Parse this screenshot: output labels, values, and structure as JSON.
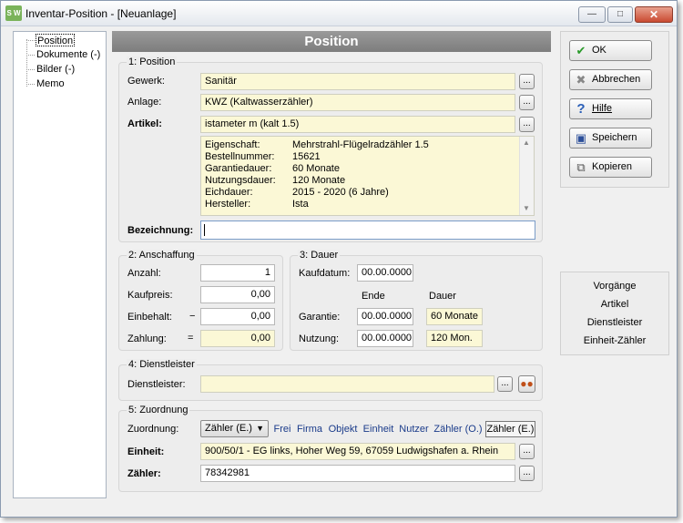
{
  "window": {
    "title": "Inventar-Position - [Neuanlage]",
    "icon_text": "S W"
  },
  "tree": {
    "items": [
      "Position",
      "Dokumente (-)",
      "Bilder (-)",
      "Memo"
    ]
  },
  "header": {
    "title": "Position"
  },
  "position": {
    "group_title": "1: Position",
    "gewerk_label": "Gewerk:",
    "gewerk_value": "Sanitär",
    "anlage_label": "Anlage:",
    "anlage_value": "KWZ (Kaltwasserzähler)",
    "artikel_label": "Artikel:",
    "artikel_value": "istameter m (kalt 1.5)",
    "info": [
      {
        "key": "Eigenschaft:",
        "value": "Mehrstrahl-Flügelradzähler 1.5"
      },
      {
        "key": "Bestellnummer:",
        "value": "15621"
      },
      {
        "key": "Garantiedauer:",
        "value": "60 Monate"
      },
      {
        "key": "Nutzungsdauer:",
        "value": "120 Monate"
      },
      {
        "key": "Eichdauer:",
        "value": "2015 - 2020 (6 Jahre)"
      },
      {
        "key": "Hersteller:",
        "value": "Ista"
      }
    ],
    "bezeichnung_label": "Bezeichnung:",
    "bezeichnung_value": ""
  },
  "anschaffung": {
    "group_title": "2: Anschaffung",
    "anzahl_label": "Anzahl:",
    "anzahl_value": "1",
    "kaufpreis_label": "Kaufpreis:",
    "kaufpreis_value": "0,00",
    "einbehalt_label": "Einbehalt:",
    "einbehalt_sign": "−",
    "einbehalt_value": "0,00",
    "zahlung_label": "Zahlung:",
    "zahlung_sign": "=",
    "zahlung_value": "0,00"
  },
  "dauer": {
    "group_title": "3: Dauer",
    "kaufdatum_label": "Kaufdatum:",
    "kaufdatum_value": "00.00.0000",
    "col_ende": "Ende",
    "col_dauer": "Dauer",
    "garantie_label": "Garantie:",
    "garantie_ende": "00.00.0000",
    "garantie_dauer": "60 Monate",
    "nutzung_label": "Nutzung:",
    "nutzung_ende": "00.00.0000",
    "nutzung_dauer": "120 Mon."
  },
  "dienstleister": {
    "group_title": "4: Dienstleister",
    "label": "Dienstleister:",
    "value": ""
  },
  "zuordnung": {
    "group_title": "5: Zuordnung",
    "label": "Zuordnung:",
    "select_value": "Zähler (E.)",
    "tabs": [
      "Frei",
      "Firma",
      "Objekt",
      "Einheit",
      "Nutzer",
      "Zähler (O.)",
      "Zähler (E.)"
    ],
    "einheit_label": "Einheit:",
    "einheit_value": "900/50/1 - EG links, Hoher Weg 59, 67059 Ludwigshafen a. Rhein",
    "zaehler_label": "Zähler:",
    "zaehler_value": "78342981"
  },
  "buttons": {
    "ok": "OK",
    "abbrechen": "Abbrechen",
    "hilfe": "Hilfe",
    "speichern": "Speichern",
    "kopieren": "Kopieren"
  },
  "links": [
    "Vorgänge",
    "Artikel",
    "Dienstleister",
    "Einheit-Zähler"
  ],
  "colors": {
    "field_yellow": "#fbf8d6",
    "header_gray": "#8a8a8a",
    "tab_blue": "#1a3b8a"
  }
}
